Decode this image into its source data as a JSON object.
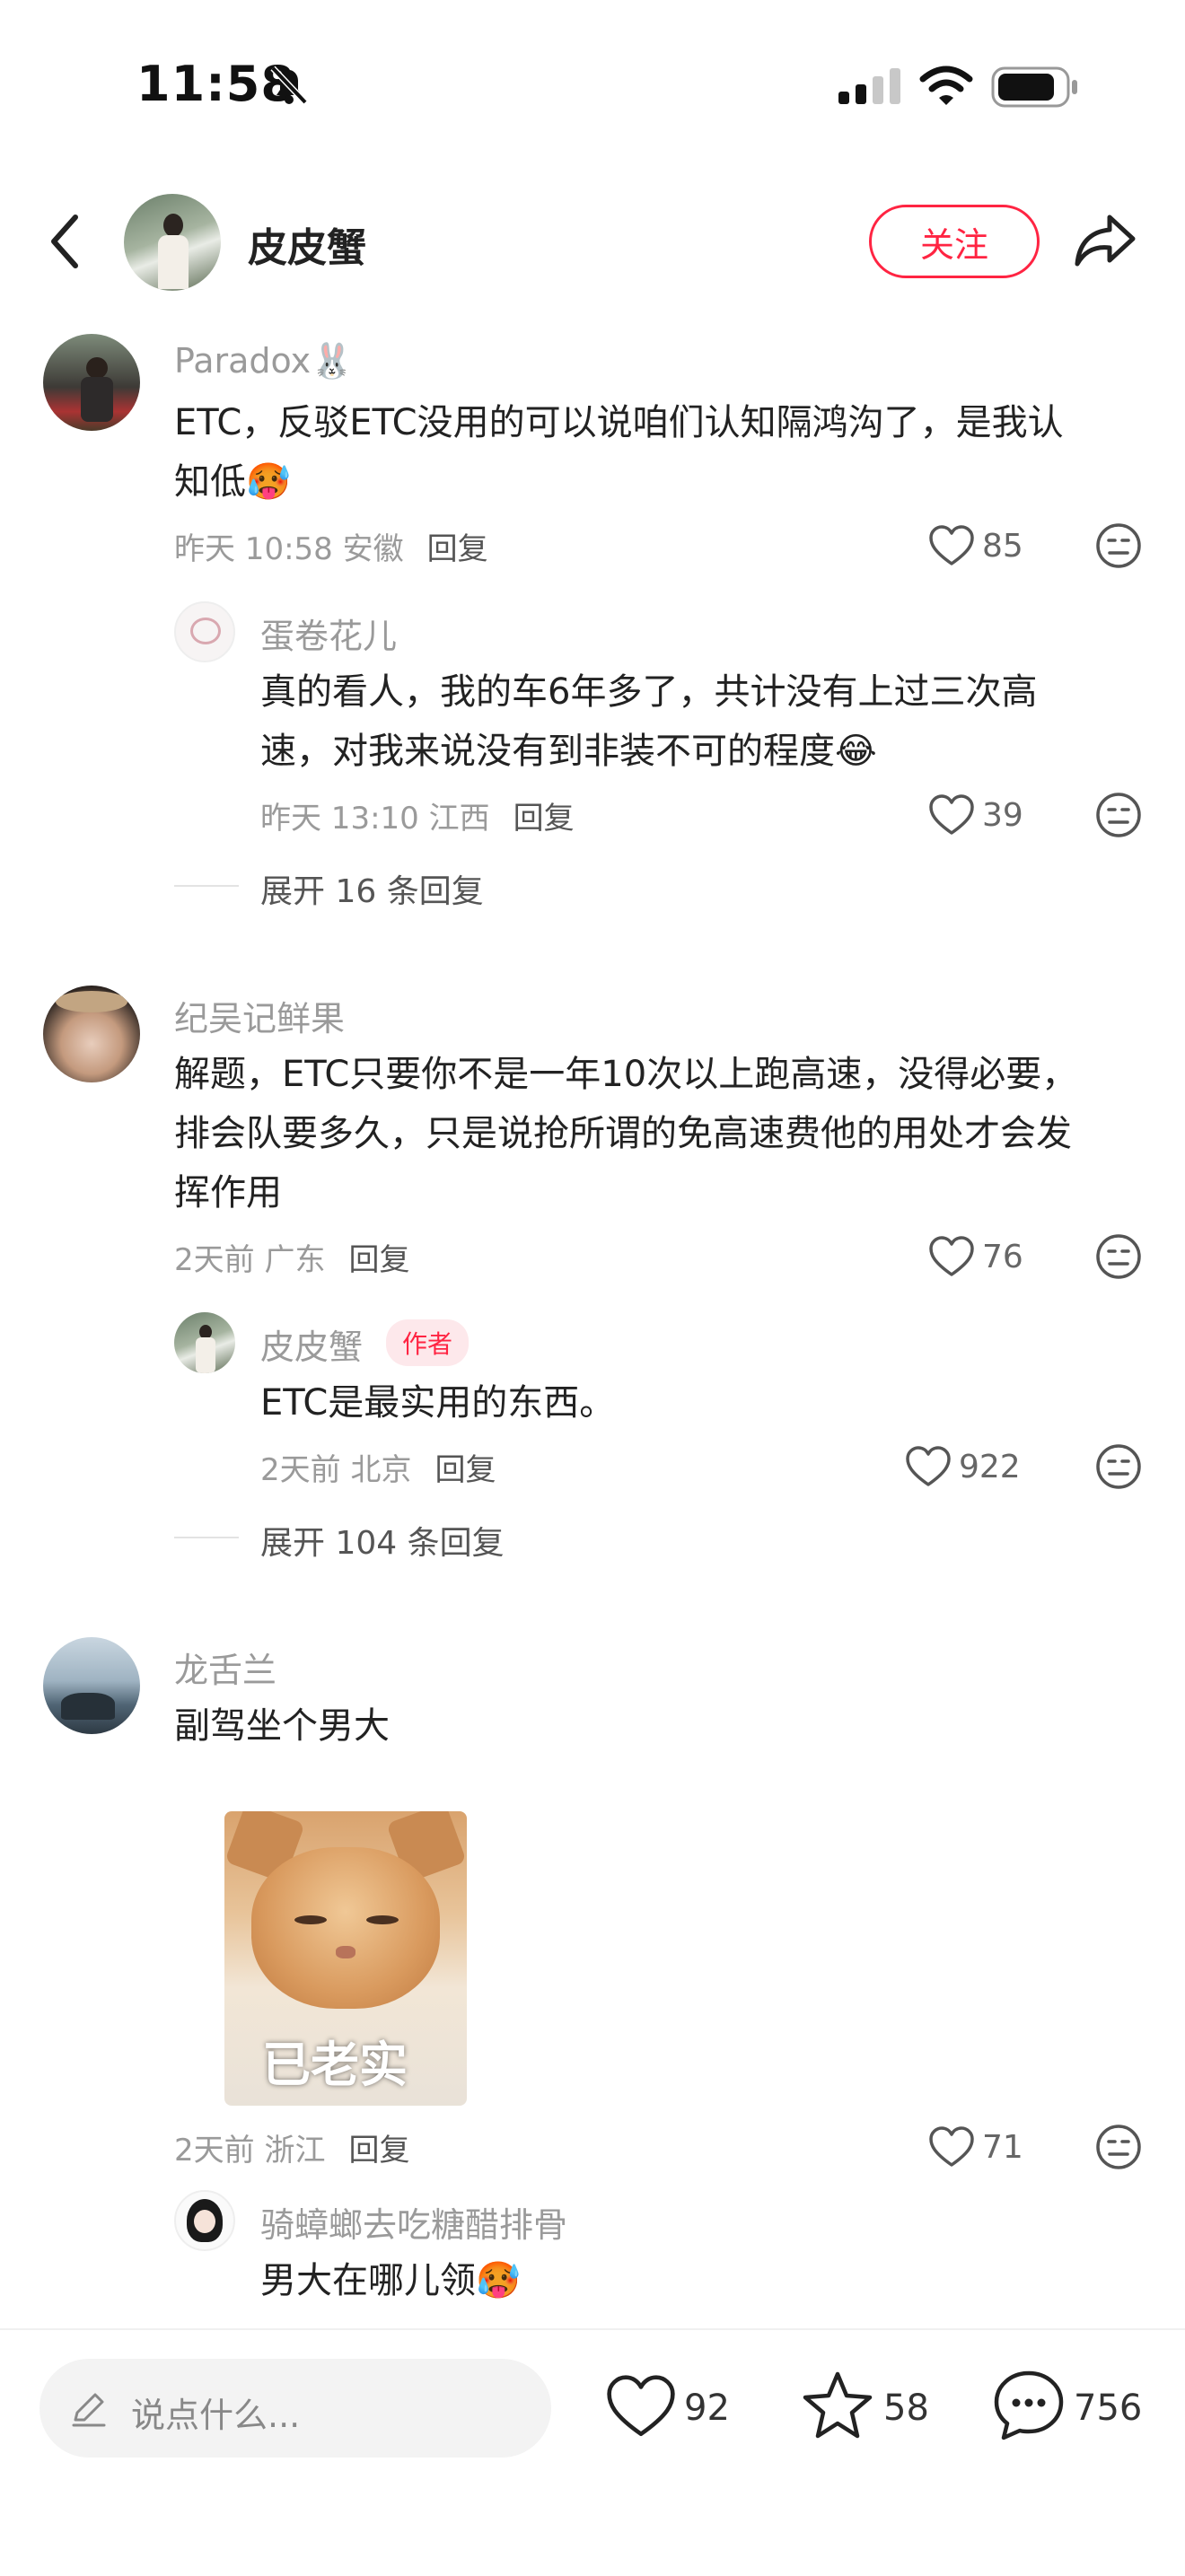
{
  "status": {
    "time": "11:58"
  },
  "nav": {
    "name": "皮皮蟹",
    "follow_label": "关注"
  },
  "comments": [
    {
      "username": "Paradox🐰",
      "text_line1": "ETC，反驳ETC没用的可以说咱们认知隔鸿沟了，是我认",
      "text_line2": "知低🥵",
      "time": "昨天 10:58 安徽",
      "reply_label": "回复",
      "likes": "85",
      "reply": {
        "username": "蛋卷花儿",
        "text_line1": "真的看人，我的车6年多了，共计没有上过三次高",
        "text_line2": "速，对我来说没有到非装不可的程度😂",
        "time": "昨天 13:10 江西",
        "reply_label": "回复",
        "likes": "39"
      },
      "expand": "展开 16 条回复"
    },
    {
      "username": "纪吴记鲜果",
      "text_line1": "解题，ETC只要你不是一年10次以上跑高速，没得必要，",
      "text_line2": "排会队要多久，只是说抢所谓的免高速费他的用处才会发",
      "text_line3": "挥作用",
      "time": "2天前 广东",
      "reply_label": "回复",
      "likes": "76",
      "reply": {
        "username": "皮皮蟹",
        "badge": "作者",
        "text_line1": "ETC是最实用的东西。",
        "time": "2天前 北京",
        "reply_label": "回复",
        "likes": "922"
      },
      "expand": "展开 104 条回复"
    },
    {
      "username": "龙舌兰",
      "text_line1": "副驾坐个男大",
      "sticker_text": "已老实",
      "time": "2天前 浙江",
      "reply_label": "回复",
      "likes": "71",
      "reply": {
        "username": "骑蟑螂去吃糖醋排骨",
        "text_line1": "男大在哪儿领🥵"
      }
    }
  ],
  "bottom": {
    "placeholder": "说点什么...",
    "likes": "92",
    "stars": "58",
    "comments": "756"
  },
  "colors": {
    "accent": "#ff2442",
    "muted": "#9a9a9a"
  }
}
